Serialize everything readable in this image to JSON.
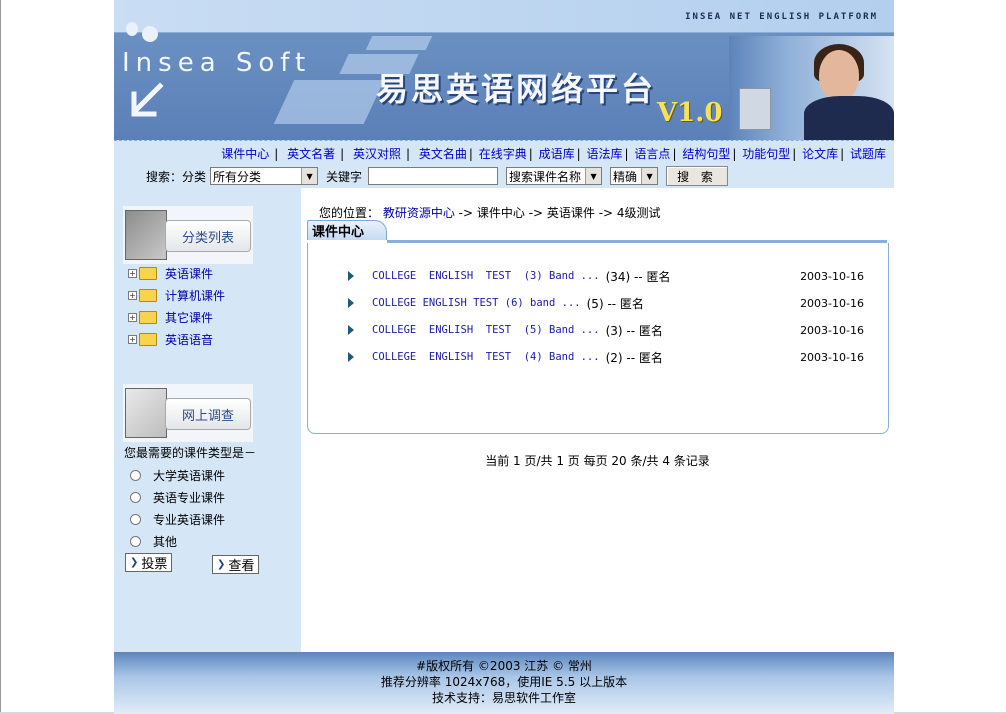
{
  "header": {
    "platform_tag": "INSEA NET ENGLISH PLATFORM",
    "brand": "Insea Soft",
    "title": "易思英语网络平台",
    "version": "V1.0"
  },
  "nav": {
    "menu": [
      "课件中心",
      "英文名著",
      "英汉对照",
      "英文名曲",
      "在线字典",
      "成语库",
      "语法库",
      "语言点",
      "结构句型",
      "功能句型",
      "论文库",
      "试题库"
    ]
  },
  "search": {
    "label": "搜索：分类",
    "category_value": "所有分类",
    "keyword_label": "关键字",
    "keyword_value": "",
    "field_value": "搜索课件名称",
    "mode_value": "精确",
    "button": "搜 索"
  },
  "sidebar": {
    "category_title": "分类列表",
    "categories": [
      "英语课件",
      "计算机课件",
      "其它课件",
      "英语语音"
    ],
    "survey_title": "网上调查",
    "survey_question": "您最需要的课件类型是－",
    "options": [
      "大学英语课件",
      "英语专业课件",
      "专业英语课件",
      "其他"
    ],
    "vote_button": "投票",
    "view_button": "查看"
  },
  "breadcrumb": {
    "prefix": "您的位置：",
    "root": "教研资源中心",
    "path": " -> 课件中心 -> 英语课件 -> 4级测试"
  },
  "panel": {
    "title": "课件中心",
    "courses": [
      {
        "title": "COLLEGE  ENGLISH  TEST  (3) Band ...",
        "meta": "(34) -- 匿名",
        "date": "2003-10-16"
      },
      {
        "title": "COLLEGE ENGLISH TEST (6) band ...",
        "meta": "(5) -- 匿名",
        "date": "2003-10-16"
      },
      {
        "title": "COLLEGE  ENGLISH  TEST  (5) Band ...",
        "meta": "(3) -- 匿名",
        "date": "2003-10-16"
      },
      {
        "title": "COLLEGE  ENGLISH  TEST  (4) Band ...",
        "meta": "(2) -- 匿名",
        "date": "2003-10-16"
      }
    ]
  },
  "pager": {
    "text": "当前 1 页/共 1 页 每页 20 条/共 4 条记录"
  },
  "footer": {
    "copyright": "#版权所有 ©2003 江苏 © 常州",
    "resolution": "推荐分辨率 1024x768，使用IE 5.5 以上版本",
    "support": "技术支持：易思软件工作室"
  }
}
